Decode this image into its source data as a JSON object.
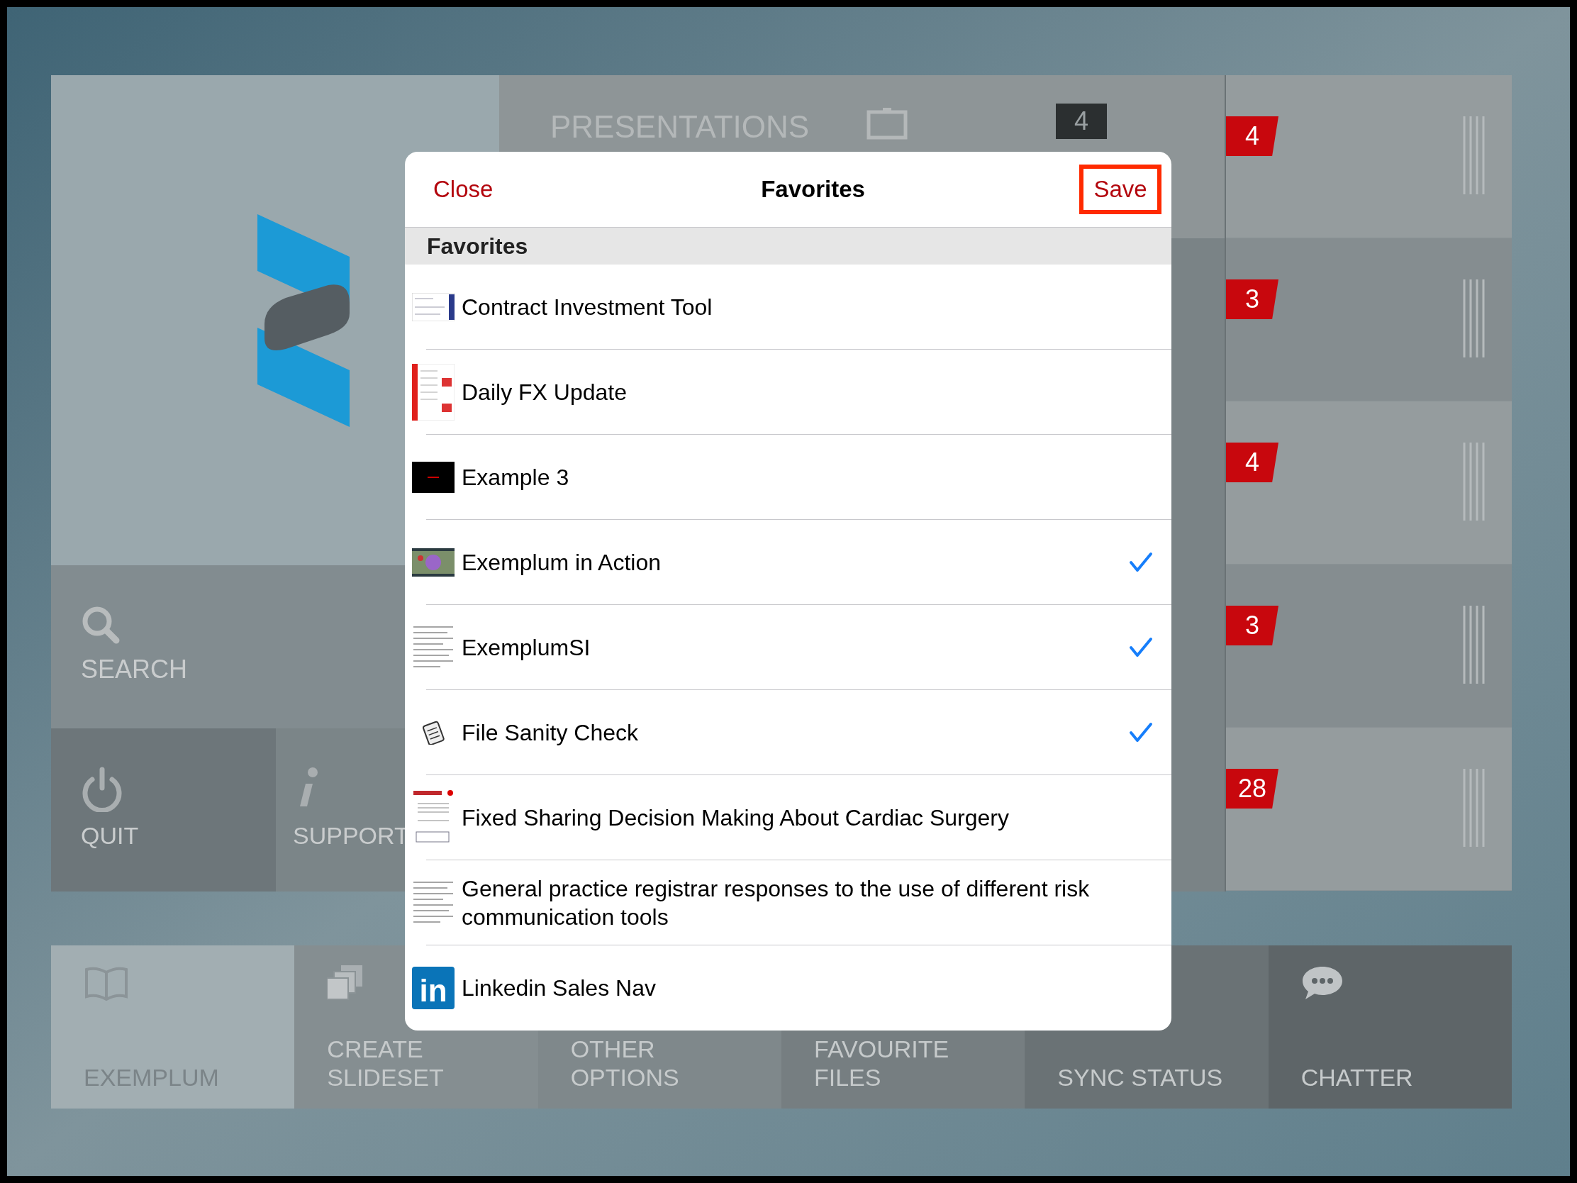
{
  "background": {
    "presentations": {
      "label": "PRESENTATIONS",
      "badge": "4"
    },
    "search_tile": {
      "label": "SEARCH"
    },
    "small_tiles": [
      {
        "kind": "quit",
        "label": "QUIT"
      },
      {
        "kind": "support",
        "label": "SUPPORT"
      }
    ],
    "right_rows": [
      {
        "badge": "4"
      },
      {
        "badge": "3"
      },
      {
        "badge": "4"
      },
      {
        "badge": "3"
      },
      {
        "badge": "28"
      }
    ],
    "bottom_tiles": [
      {
        "kind": "book",
        "lines": [
          "EXEMPLUM"
        ],
        "selected": true
      },
      {
        "kind": "stack",
        "lines": [
          "CREATE",
          "SLIDESET"
        ],
        "selected": false
      },
      {
        "kind": "none",
        "lines": [
          "OTHER",
          "OPTIONS"
        ],
        "selected": false
      },
      {
        "kind": "none",
        "lines": [
          "FAVOURITE",
          "FILES"
        ],
        "selected": false
      },
      {
        "kind": "none",
        "lines": [
          "SYNC STATUS"
        ],
        "selected": false
      },
      {
        "kind": "chat",
        "lines": [
          "CHATTER"
        ],
        "selected": false
      }
    ]
  },
  "dialog": {
    "close": "Close",
    "title": "Favorites",
    "save": "Save",
    "section": "Favorites",
    "items": [
      {
        "title": "Contract Investment Tool",
        "kind": "table",
        "checked": false
      },
      {
        "title": "Daily FX Update",
        "kind": "report",
        "checked": false
      },
      {
        "title": "Example 3",
        "kind": "dark",
        "checked": false
      },
      {
        "title": "Exemplum in Action",
        "kind": "video",
        "checked": true
      },
      {
        "title": "ExemplumSI",
        "kind": "document",
        "checked": true
      },
      {
        "title": "File Sanity Check",
        "kind": "clipboard",
        "checked": true
      },
      {
        "title": "Fixed Sharing Decision Making About Cardiac Surgery",
        "kind": "article",
        "checked": false
      },
      {
        "title": "General practice registrar responses to the use of different risk communication tools",
        "kind": "document",
        "checked": false
      },
      {
        "title": "Linkedin Sales Nav",
        "kind": "linkedin",
        "logo_text": "in",
        "checked": false
      }
    ]
  }
}
